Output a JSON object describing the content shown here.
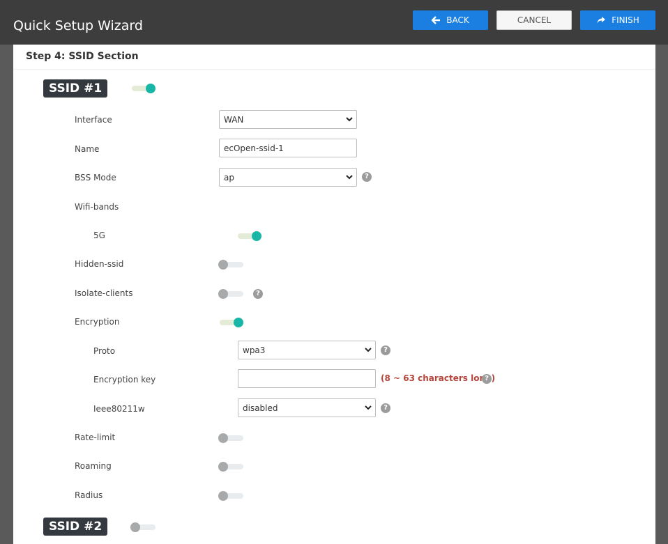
{
  "header": {
    "title": "Quick Setup Wizard",
    "back_label": "BACK",
    "cancel_label": "CANCEL",
    "finish_label": "FINISH"
  },
  "step": {
    "title": "Step 4: SSID Section"
  },
  "ssid1": {
    "badge": "SSID #1",
    "enabled": true,
    "interface": {
      "label": "Interface",
      "value": "WAN"
    },
    "name": {
      "label": "Name",
      "value": "ecOpen-ssid-1"
    },
    "bss_mode": {
      "label": "BSS Mode",
      "value": "ap"
    },
    "wifi_bands": {
      "label": "Wifi-bands"
    },
    "band_5g": {
      "label": "5G",
      "enabled": true
    },
    "hidden_ssid": {
      "label": "Hidden-ssid",
      "enabled": false
    },
    "isolate_clients": {
      "label": "Isolate-clients",
      "enabled": false
    },
    "encryption": {
      "label": "Encryption",
      "enabled": true
    },
    "proto": {
      "label": "Proto",
      "value": "wpa3"
    },
    "encryption_key": {
      "label": "Encryption key",
      "value": "",
      "hint": "(8 ~ 63 characters long)"
    },
    "ieee80211w": {
      "label": "Ieee80211w",
      "value": "disabled"
    },
    "rate_limit": {
      "label": "Rate-limit",
      "enabled": false
    },
    "roaming": {
      "label": "Roaming",
      "enabled": false
    },
    "radius": {
      "label": "Radius",
      "enabled": false
    }
  },
  "ssid2": {
    "badge": "SSID #2",
    "enabled": false
  },
  "colors": {
    "primary": "#1a7fe0",
    "toggle_on": "#17b6a6",
    "toggle_off": "#a7a9ab",
    "hint": "#b5453a",
    "badge_bg": "#33393f"
  }
}
